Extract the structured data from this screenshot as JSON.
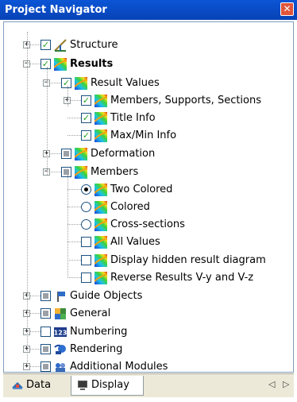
{
  "window": {
    "title": "Project Navigator"
  },
  "colors": {
    "accent": "#0842B5",
    "check": "#21A121"
  },
  "tree": [
    {
      "label": "Structure",
      "bold": false,
      "control": "checked",
      "icon": "structure-icon",
      "name": "structure"
    },
    {
      "label": "Results",
      "bold": true,
      "control": "checked",
      "icon": "results-icon",
      "name": "results"
    },
    {
      "label": "Result Values",
      "bold": false,
      "control": "checked",
      "icon": "results-icon",
      "name": "result-values"
    },
    {
      "label": "Members, Supports, Sections",
      "bold": false,
      "control": "checked",
      "icon": "results-icon",
      "name": "members-supports-sections"
    },
    {
      "label": "Title Info",
      "bold": false,
      "control": "checked",
      "icon": "results-icon",
      "name": "title-info"
    },
    {
      "label": "Max/Min Info",
      "bold": false,
      "control": "checked",
      "icon": "results-icon",
      "name": "max-min-info"
    },
    {
      "label": "Deformation",
      "bold": false,
      "control": "mixed",
      "icon": "results-icon",
      "name": "deformation"
    },
    {
      "label": "Members",
      "bold": false,
      "control": "mixed",
      "icon": "results-icon",
      "name": "members"
    },
    {
      "label": "Two Colored",
      "bold": false,
      "control": "radio-selected",
      "icon": "results-icon",
      "name": "two-colored"
    },
    {
      "label": "Colored",
      "bold": false,
      "control": "radio",
      "icon": "results-icon",
      "name": "colored"
    },
    {
      "label": "Cross-sections",
      "bold": false,
      "control": "radio",
      "icon": "results-icon",
      "name": "cross-sections"
    },
    {
      "label": "All Values",
      "bold": false,
      "control": "unchecked",
      "icon": "results-icon",
      "name": "all-values"
    },
    {
      "label": "Display hidden result diagram",
      "bold": false,
      "control": "unchecked",
      "icon": "results-icon",
      "name": "display-hidden-result-diagram"
    },
    {
      "label": "Reverse Results V-y and V-z",
      "bold": false,
      "control": "unchecked",
      "icon": "results-icon",
      "name": "reverse-results"
    },
    {
      "label": "Guide Objects",
      "bold": false,
      "control": "mixed",
      "icon": "guide-objects-icon",
      "name": "guide-objects"
    },
    {
      "label": "General",
      "bold": false,
      "control": "mixed",
      "icon": "general-icon",
      "name": "general"
    },
    {
      "label": "Numbering",
      "bold": false,
      "control": "unchecked",
      "icon": "numbering-icon",
      "name": "numbering"
    },
    {
      "label": "Rendering",
      "bold": false,
      "control": "mixed",
      "icon": "rendering-icon",
      "name": "rendering"
    },
    {
      "label": "Additional Modules",
      "bold": false,
      "control": "mixed",
      "icon": "additional-modules-icon",
      "name": "additional-modules"
    }
  ],
  "tabs": [
    {
      "label": "Data",
      "active": false,
      "icon": "data-icon"
    },
    {
      "label": "Display",
      "active": true,
      "icon": "display-icon"
    }
  ]
}
